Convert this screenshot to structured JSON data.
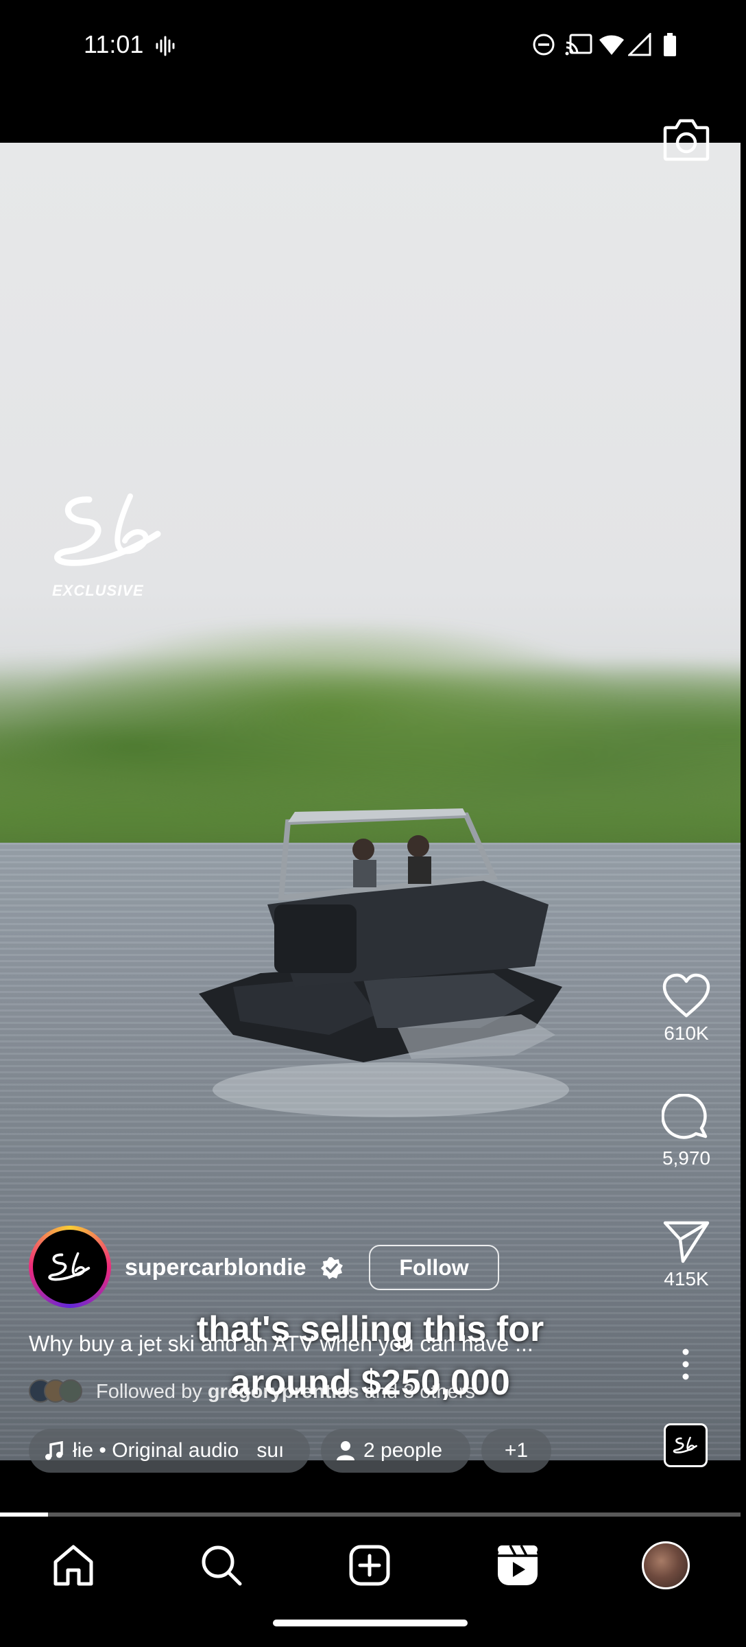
{
  "status_bar": {
    "time": "11:01",
    "icons": [
      "voice-wave-icon",
      "do-not-disturb-icon",
      "cast-icon",
      "wifi-icon",
      "cell-signal-icon",
      "battery-icon"
    ]
  },
  "video": {
    "logo_text": "Sb",
    "exclusive_label": "EXCLUSIVE",
    "caption_line1": "that's selling this for",
    "caption_line2": "around $250,000"
  },
  "rail": {
    "likes": "610K",
    "comments": "5,970",
    "shares": "415K"
  },
  "post": {
    "username": "supercarblondie",
    "follow_label": "Follow",
    "caption": "Why buy a jet ski and an ATV when you can have ...",
    "followed_prefix": "Followed by ",
    "followed_user": "gregoryprentiss",
    "followed_suffix": " and 3 others",
    "audio_label": "łie • Original audio",
    "audio_tail": "suı",
    "people_label": "2 people",
    "plus_label": "+1"
  },
  "progress": {
    "fraction": 0.065
  },
  "nav": {
    "items": [
      "home-icon",
      "search-icon",
      "create-icon",
      "reels-icon",
      "profile-avatar"
    ]
  },
  "colors": {
    "background": "#000000",
    "ring_start": "#f9ce34",
    "ring_mid": "#ee2a7b",
    "ring_end": "#6228d7"
  }
}
